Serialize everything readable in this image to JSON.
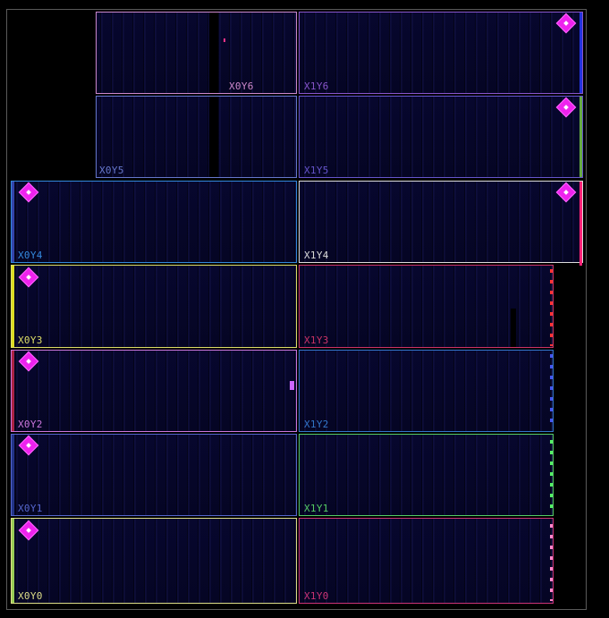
{
  "regions": [
    {
      "label": "X0Y6",
      "color": "#cc88cc"
    },
    {
      "label": "X1Y6",
      "color": "#8855cc"
    },
    {
      "label": "X0Y5",
      "color": "#6677cc"
    },
    {
      "label": "X1Y5",
      "color": "#6655cc"
    },
    {
      "label": "X0Y4",
      "color": "#3388dd"
    },
    {
      "label": "X1Y4",
      "color": "#dddddd"
    },
    {
      "label": "X0Y3",
      "color": "#dddd66"
    },
    {
      "label": "X1Y3",
      "color": "#cc3366"
    },
    {
      "label": "X0Y2",
      "color": "#cc77dd"
    },
    {
      "label": "X1Y2",
      "color": "#3377cc"
    },
    {
      "label": "X0Y1",
      "color": "#5566cc"
    },
    {
      "label": "X1Y1",
      "color": "#55cc66"
    },
    {
      "label": "X0Y0",
      "color": "#dddd88"
    },
    {
      "label": "X1Y0",
      "color": "#cc3377"
    }
  ],
  "colors": {
    "clock_root": "#ee22ee",
    "die_border": "#5a5a5a",
    "background": "#000000"
  }
}
